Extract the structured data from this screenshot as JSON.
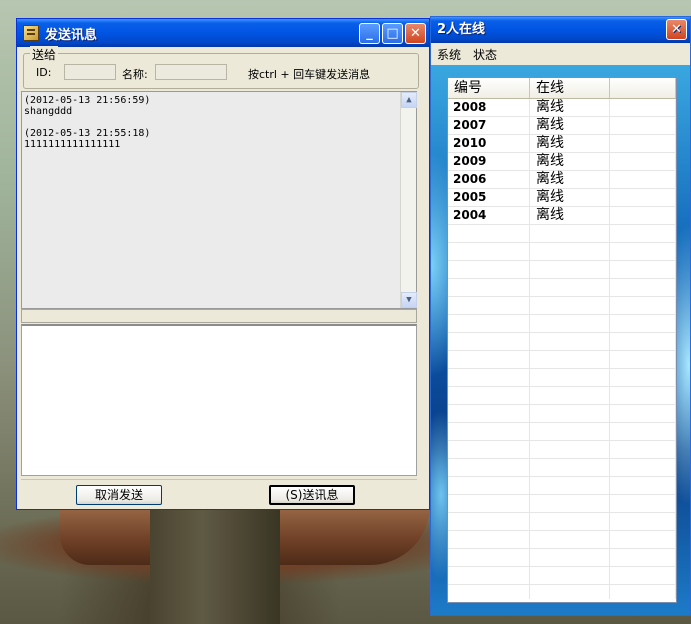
{
  "left_window": {
    "title": "发送讯息",
    "controls": {
      "minimize": "_",
      "maximize": "□",
      "close": "✕"
    },
    "send_to": {
      "legend": "送给",
      "id_label": "ID:",
      "id_value": "",
      "name_label": "名称:",
      "name_value": "",
      "hint": "按ctrl + 回车键发送消息"
    },
    "history": [
      {
        "time": "(2012-05-13 21:56:59)",
        "text": "shangddd"
      },
      {
        "time": "(2012-05-13 21:55:18)",
        "text": "1111111111111111"
      }
    ],
    "compose_value": "",
    "buttons": {
      "cancel": "取消发送",
      "send": "(S)送讯息"
    }
  },
  "right_window": {
    "title": "2人在线",
    "close": "✕",
    "menu": [
      "系统",
      "状态"
    ],
    "columns": [
      "编号",
      "在线",
      ""
    ],
    "rows": [
      {
        "id": "2008",
        "status": "离线"
      },
      {
        "id": "2007",
        "status": "离线"
      },
      {
        "id": "2010",
        "status": "离线"
      },
      {
        "id": "2009",
        "status": "离线"
      },
      {
        "id": "2006",
        "status": "离线"
      },
      {
        "id": "2005",
        "status": "离线"
      },
      {
        "id": "2004",
        "status": "离线"
      }
    ]
  },
  "colors": {
    "titlebar": "#0054e3",
    "window_face": "#ece9d8",
    "close_button": "#d0451f"
  }
}
